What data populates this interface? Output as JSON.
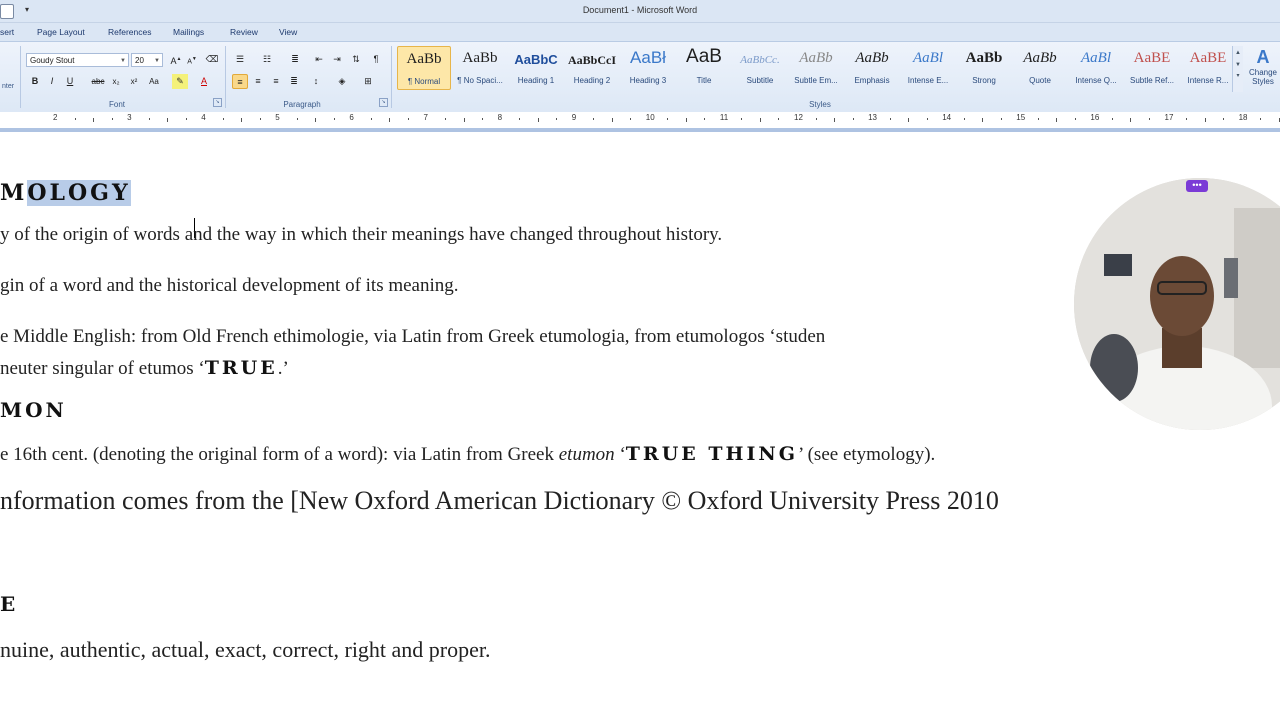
{
  "window": {
    "title": "Document1 - Microsoft Word"
  },
  "tabs": [
    {
      "label": "sert"
    },
    {
      "label": "Page Layout"
    },
    {
      "label": "References"
    },
    {
      "label": "Mailings"
    },
    {
      "label": "Review"
    },
    {
      "label": "View"
    }
  ],
  "ribbon": {
    "font_name": "Goudy Stout",
    "font_size": "20",
    "font_group_label": "Font",
    "paragraph_group_label": "Paragraph",
    "styles_group_label": "Styles",
    "clipboard_partial_label": "nter",
    "change_styles_label": "Change Styles",
    "styles": [
      {
        "sample": "AaBb",
        "name": "¶ Normal"
      },
      {
        "sample": "AaBb",
        "name": "¶ No Spaci..."
      },
      {
        "sample": "AaBbC",
        "name": "Heading 1"
      },
      {
        "sample": "AaBbCcI",
        "name": "Heading 2"
      },
      {
        "sample": "AaBł",
        "name": "Heading 3"
      },
      {
        "sample": "AaB",
        "name": "Title"
      },
      {
        "sample": "AaBbCc.",
        "name": "Subtitle"
      },
      {
        "sample": "AaBb",
        "name": "Subtle Em..."
      },
      {
        "sample": "AaBb",
        "name": "Emphasis"
      },
      {
        "sample": "AaBl",
        "name": "Intense E..."
      },
      {
        "sample": "AaBb",
        "name": "Strong"
      },
      {
        "sample": "AaBb",
        "name": "Quote"
      },
      {
        "sample": "AaBl",
        "name": "Intense Q..."
      },
      {
        "sample": "AaBE",
        "name": "Subtle Ref..."
      },
      {
        "sample": "AaBE",
        "name": "Intense R..."
      }
    ]
  },
  "ruler": {
    "numbers": [
      "2",
      "3",
      "4",
      "5",
      "6",
      "7",
      "8",
      "9",
      "10",
      "11",
      "12",
      "13",
      "14",
      "15",
      "16",
      "17",
      "18"
    ]
  },
  "document": {
    "heading1_prefix": "M",
    "heading1_selected": "OLOGY",
    "line1": "y of the origin of words and the way in which their meanings have changed throughout history.",
    "line2": "gin of a word and the historical development of its meaning.",
    "line3": "e Middle English: from Old French ethimologie, via Latin from Greek etumologia, from etumologos ‘studen",
    "line4_pre": "neuter singular of etumos ‘",
    "line4_stout": "TRUE",
    "line4_post": ".’",
    "heading2": "MON",
    "line5_pre": "e 16th cent. (denoting the original form of a word): via Latin from Greek ",
    "line5_italic": "etumon",
    "line5_mid": " ‘",
    "line5_stout": "TRUE THING",
    "line5_post": "’ (see etymology).",
    "line6": "nformation comes from the [New Oxford American Dictionary © Oxford University Press 2010",
    "heading3": "E",
    "line7": "nuine, authentic, actual, exact, correct, right and proper."
  },
  "webcam": {
    "menu_label": "•••"
  },
  "colors": {
    "ribbon_bg": "#dde8f6",
    "selection": "#b8cce8",
    "accent": "#7b3bd6"
  }
}
